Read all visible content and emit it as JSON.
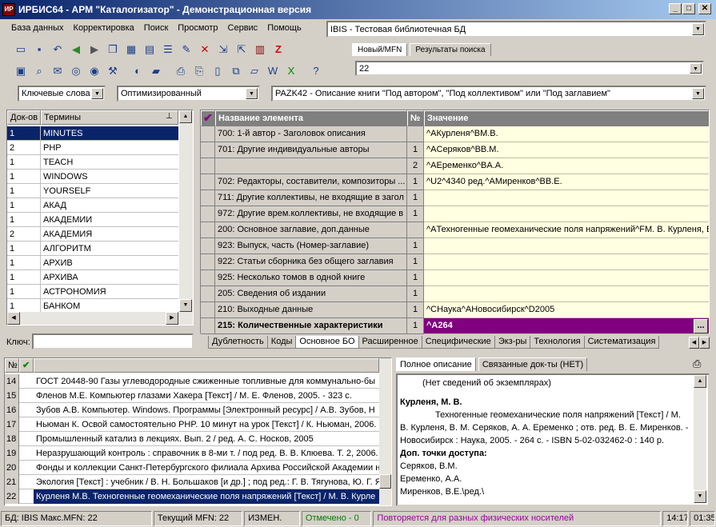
{
  "window": {
    "title": "ИРБИС64 - АРМ \"Каталогизатор\" - Демонстрационная версия",
    "min": "_",
    "max": "□",
    "close": "✕"
  },
  "menu": [
    "База данных",
    "Корректировка",
    "Поиск",
    "Просмотр",
    "Сервис",
    "Помощь"
  ],
  "db_combo": "IBIS - Тестовая библиотечная БД",
  "top_tabs": {
    "new_mfn": "Новый/MFN",
    "results": "Результаты поиска"
  },
  "mfn_value": "22",
  "search_mode": "Ключевые слова",
  "optimization": "Оптимизированный",
  "worksheet": "PAZK42 - Описание книги \"Под автором\", \"Под коллективом\" или \"Под заглавием\"",
  "terms": {
    "col_docs": "Док-ов",
    "col_terms": "Термины",
    "rows": [
      [
        "1",
        "MINUTES"
      ],
      [
        "2",
        "PHP"
      ],
      [
        "1",
        "TEACH"
      ],
      [
        "1",
        "WINDOWS"
      ],
      [
        "1",
        "YOURSELF"
      ],
      [
        "1",
        "АКАД"
      ],
      [
        "1",
        "АКАДЕМИИ"
      ],
      [
        "2",
        "АКАДЕМИЯ"
      ],
      [
        "1",
        "АЛГОРИТМ"
      ],
      [
        "1",
        "АРХИВ"
      ],
      [
        "1",
        "АРХИВА"
      ],
      [
        "1",
        "АСТРОНОМИЯ"
      ],
      [
        "1",
        "БАНКОМ"
      ]
    ]
  },
  "key_label": "Ключ:",
  "fields": {
    "col_name": "Название элемента",
    "col_num": "№",
    "col_value": "Значение",
    "rows": [
      [
        "700: 1-й автор - Заголовок описания",
        "",
        "^AКурленя^BМ.В."
      ],
      [
        "701: Другие индивидуальные авторы",
        "1",
        "^AСеряков^BВ.М."
      ],
      [
        "",
        "2",
        "^AЕременко^BА.А."
      ],
      [
        "702: Редакторы, составители, композиторы ...",
        "1",
        "^U2^4340 ред.^AМиренков^BВ.Е."
      ],
      [
        "711: Другие коллективы, не входящие в загол",
        "1",
        ""
      ],
      [
        "972: Другие врем.коллективы, не входящие в",
        "1",
        ""
      ],
      [
        "200: Основное заглавие, доп.данные",
        "",
        "^AТехногенные геомеханические поля напряжений^FМ. В. Курленя, В"
      ],
      [
        "923: Выпуск, часть (Номер-заглавие)",
        "1",
        ""
      ],
      [
        "922: Статьи сборника без общего заглавия",
        "1",
        ""
      ],
      [
        "925: Несколько томов в одной книге",
        "1",
        ""
      ],
      [
        "205: Сведения об издании",
        "1",
        ""
      ],
      [
        "210: Выходные данные",
        "1",
        "^CНаука^AНовосибирск^D2005"
      ],
      [
        "215: Количественные характеристики",
        "1",
        "^A264"
      ]
    ]
  },
  "field_tabs": [
    "Дублетность",
    "Коды",
    "Основное БО",
    "Расширенное",
    "Специфические",
    "Экз-ры",
    "Технология",
    "Систематизация"
  ],
  "records": {
    "col_num": "№",
    "rows": [
      [
        "14",
        "ГОСТ 20448-90 Газы углеводородные сжиженные топливные для коммунально-бы"
      ],
      [
        "15",
        "Фленов М.Е. Компьютер глазами Хакера [Текст] / М. Е. Фленов, 2005. - 323 с."
      ],
      [
        "16",
        "Зубов А.В. Компьютер. Windows. Программы [Электронный ресурс] / А.В. Зубов, Н"
      ],
      [
        "17",
        "Ньюман К. Освой самостоятельно PHP. 10 минут на урок [Текст] / К. Ньюман, 2006."
      ],
      [
        "18",
        "Промышленный катализ в лекциях. Вып. 2 / ред. А. С. Носков, 2005"
      ],
      [
        "19",
        "Неразрушающий контроль : справочник в 8-ми т. / под ред. В. В. Клюева. Т. 2, 2006."
      ],
      [
        "20",
        "Фонды и коллекции Санкт-Петербургского филиала Архива Российской Академии н"
      ],
      [
        "21",
        "Экология [Текст] : учебник / В. Н. Большаков [и др.] ; под ред.: Г. В. Тягунова, Ю. Г. Я"
      ],
      [
        "22",
        "Курленя М.В. Техногенные геомеханические поля напряжений [Текст] / М. В. Курле"
      ]
    ]
  },
  "desc_tabs": {
    "full": "Полное описание",
    "linked": "Связанные док-ты (НЕТ)"
  },
  "desc": {
    "no_copies": "(Нет сведений об экземплярах)",
    "heading": "Курленя, М. В.",
    "body": "Техногенные геомеханические поля напряжений [Текст] / М. В. Курленя, В. М. Серяков, А. А. Еременко ; отв. ред. В. Е. Миренков. - Новосибирск : Наука, 2005. - 264 с. - ISBN 5-02-032462-0 : 140 р.",
    "access_label": "Доп. точки доступа:",
    "access": [
      "Серяков, В.М.",
      "Еременко, А.А.",
      "Миренков, В.Е.\\ред.\\"
    ]
  },
  "status": {
    "db": "БД: IBIS Макс.MFN: 22",
    "cur": "Текущий MFN: 22",
    "changed": "ИЗМЕН.",
    "marked": "Отмечено - 0",
    "repeat": "Повторяется для разных физических носителей",
    "time": "14:17",
    "elapsed": "01:35"
  },
  "colors": {
    "title_start": "#0a246a",
    "selection": "#0a246a",
    "edit_purple": "#800080",
    "yellow": "#ffffe1",
    "green": "#008000",
    "magenta": "#a000a0"
  }
}
